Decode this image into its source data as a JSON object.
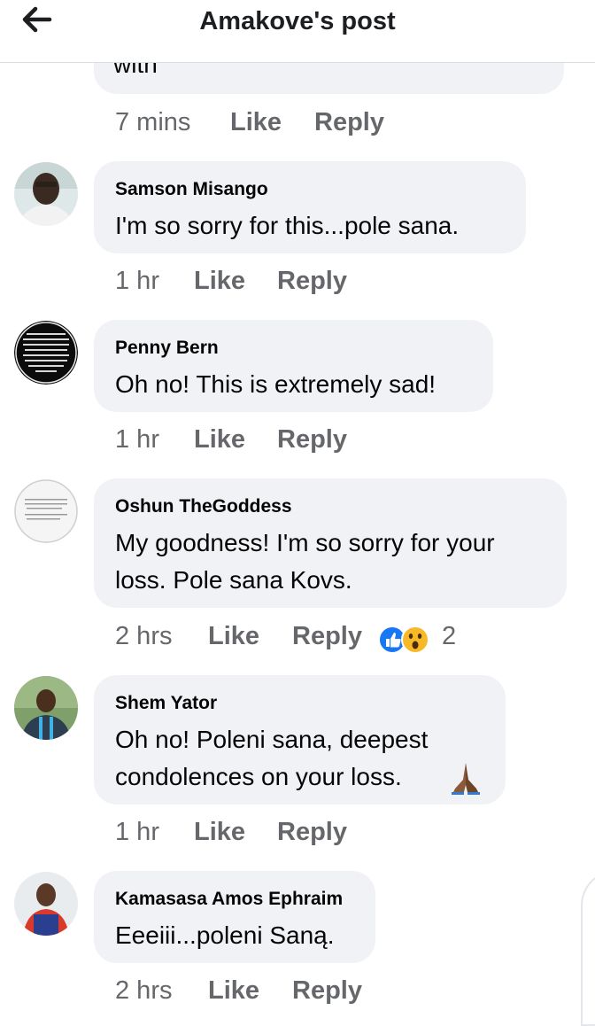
{
  "header": {
    "title": "Amakove's post",
    "back_icon": "arrow-left-icon"
  },
  "first_comment": {
    "partial_text": "with",
    "time": "7 mins",
    "like": "Like",
    "reply": "Reply"
  },
  "comments": [
    {
      "author": "Samson Misango",
      "text_lines": [
        "I'm so sorry for this...pole sana."
      ],
      "time": "1 hr",
      "like": "Like",
      "reply": "Reply"
    },
    {
      "author": "Penny Bern",
      "text_lines": [
        "Oh no! This is extremely sad!"
      ],
      "time": "1 hr",
      "like": "Like",
      "reply": "Reply"
    },
    {
      "author": "Oshun TheGoddess",
      "text_lines": [
        "My goodness! I'm so sorry for your",
        "loss. Pole sana Kovs."
      ],
      "time": "2 hrs",
      "like": "Like",
      "reply": "Reply",
      "reaction_count": "2",
      "reactions": [
        "like-reaction-icon",
        "wow-reaction-icon"
      ]
    },
    {
      "author": "Shem Yator",
      "text_lines": [
        "Oh no! Poleni sana, deepest",
        "condolences on your loss."
      ],
      "time": "1 hr",
      "like": "Like",
      "reply": "Reply",
      "emoji": "folded-hands-icon"
    },
    {
      "author": "Kamasasa Amos Ephraim",
      "text_lines": [
        "Eeeiii...poleni Saną."
      ],
      "time": "2 hrs",
      "like": "Like",
      "reply": "Reply"
    }
  ],
  "colors": {
    "bubble": "#f0f2f5",
    "meta_text": "#65676b",
    "like_blue": "#1877f2",
    "wow_yellow": "#f7b928"
  }
}
